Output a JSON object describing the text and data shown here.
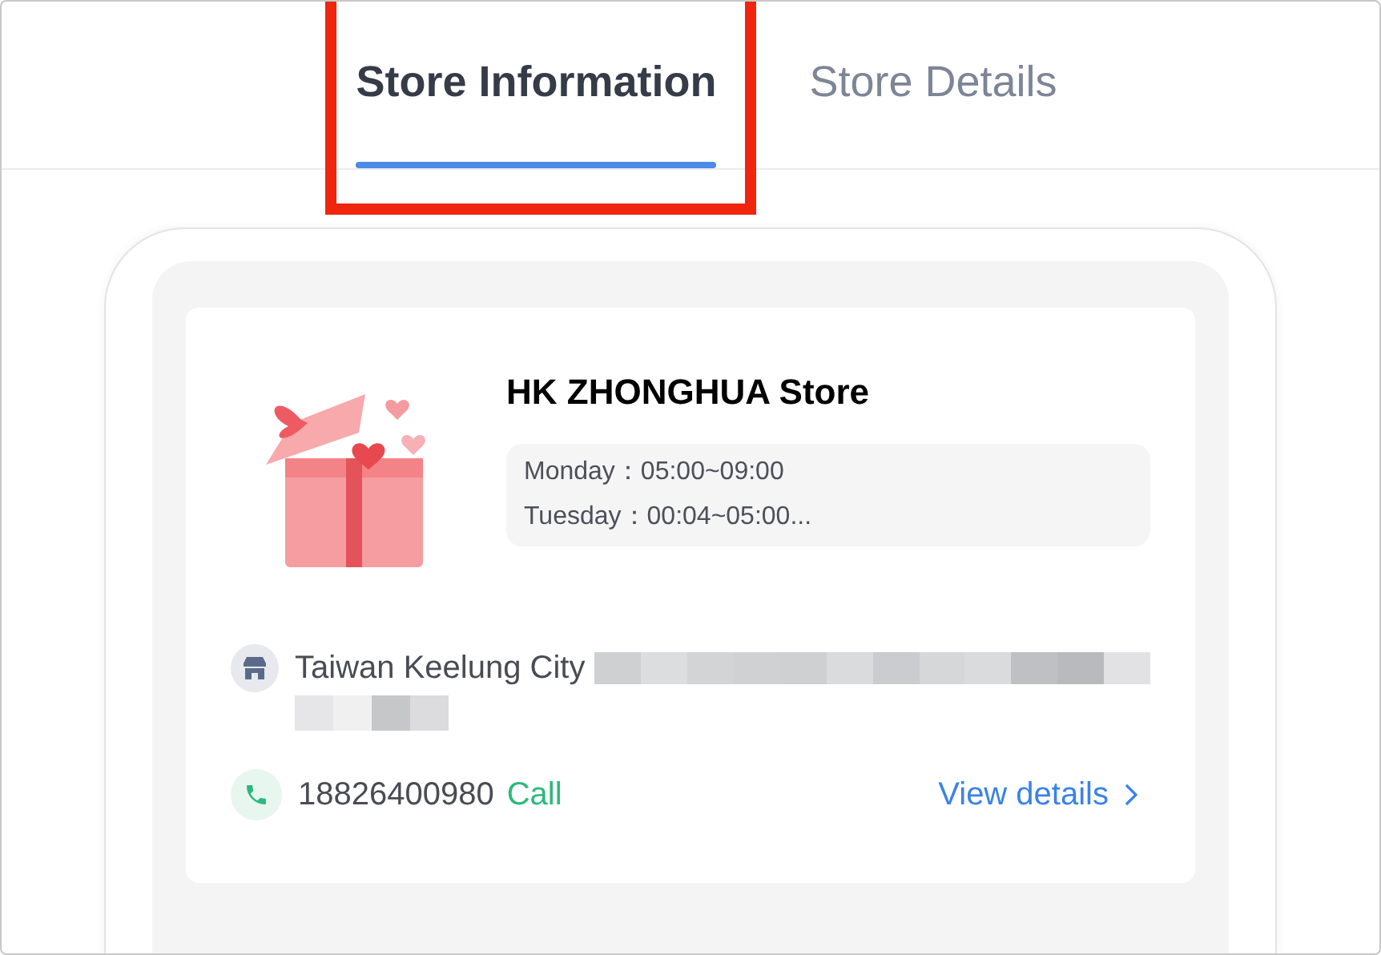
{
  "tabs": [
    {
      "label": "Store Information",
      "selected": true,
      "highlighted": true
    },
    {
      "label": "Store Details",
      "selected": false,
      "highlighted": false
    }
  ],
  "store": {
    "name": "HK ZHONGHUA Store",
    "hours": [
      "Monday：05:00~09:00",
      "Tuesday：00:04~05:00..."
    ],
    "address": "Taiwan Keelung City",
    "phone": "18826400980",
    "call_label": "Call",
    "details_link": "View details"
  }
}
